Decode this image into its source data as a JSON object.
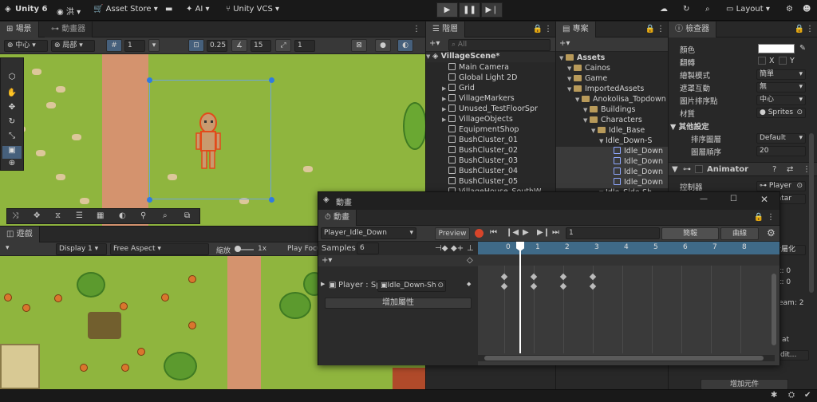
{
  "topbar": {
    "product": "Unity 6",
    "user": "洪",
    "asset_store": "Asset Store",
    "ai": "AI",
    "vcs": "Unity VCS",
    "layout": "Layout"
  },
  "scene_tabs": {
    "scene": "場景",
    "animator": "動畫器"
  },
  "scene_toolbar": {
    "pivot": "中心",
    "local": "局部",
    "grid_size": "1",
    "snap": "0.25",
    "angle": "15",
    "scale": "1"
  },
  "game_tab": "遊戲",
  "game_toolbar": {
    "display": "Display 1",
    "aspect": "Free Aspect",
    "zoom_label": "縮放",
    "zoom_value": "1x",
    "play_focused": "Play Focu"
  },
  "hierarchy": {
    "title": "階層",
    "search_placeholder": "All",
    "scene": "VillageScene*",
    "items": [
      "Main Camera",
      "Global Light 2D",
      "Grid",
      "VillageMarkers",
      "Unused_TestFloorSpr",
      "VillageObjects",
      "EquipmentShop",
      "BushCluster_01",
      "BushCluster_02",
      "BushCluster_03",
      "BushCluster_04",
      "BushCluster_05",
      "VillageHouse_SouthW"
    ]
  },
  "project": {
    "title": "專案",
    "items": [
      "Assets",
      "Cainos",
      "Game",
      "ImportedAssets",
      "Anokolisa_Topdown",
      "Buildings",
      "Characters",
      "Idle_Base",
      "Idle_Down-S",
      "Idle_Down",
      "Idle_Down",
      "Idle_Down",
      "Idle_Down",
      "Idle_Side-Sh"
    ]
  },
  "inspector": {
    "title": "檢查器",
    "color_label": "顏色",
    "flip_label": "翻轉",
    "flip_x": "X",
    "flip_y": "Y",
    "draw_mode_label": "繪製模式",
    "draw_mode": "簡單",
    "mask_label": "遮罩互動",
    "mask": "無",
    "sort_point_label": "圖片排序點",
    "sort_point": "中心",
    "material_label": "材質",
    "material": "Sprites",
    "other_settings": "其他設定",
    "sorting_layer_label": "排序圖層",
    "sorting_layer": "Default",
    "order_label": "圖層順序",
    "order": "20",
    "animator": "Animator",
    "controller_label": "控制器",
    "controller": "Player",
    "avatar_partial": "ratar",
    "partial_1": "新屬化",
    "partial_2": "t: 0",
    "partial_3": "t: 0",
    "partial_4": "eam: 2",
    "partial_5": "at",
    "partial_6": "dit...",
    "add_component": "增加元件"
  },
  "animation": {
    "window_title": "動畫",
    "tab": "動畫",
    "clip": "Player_Idle_Down",
    "preview": "Preview",
    "frame": "1",
    "dopesheet": "簡報",
    "curves": "曲線",
    "samples_label": "Samples",
    "samples": "6",
    "property": "Player : Sp",
    "property_sprite": "Idle_Down-Sh",
    "add_property": "增加屬性",
    "ruler": [
      "0",
      "1",
      "2",
      "3",
      "4",
      "5",
      "6",
      "7",
      "8"
    ]
  }
}
